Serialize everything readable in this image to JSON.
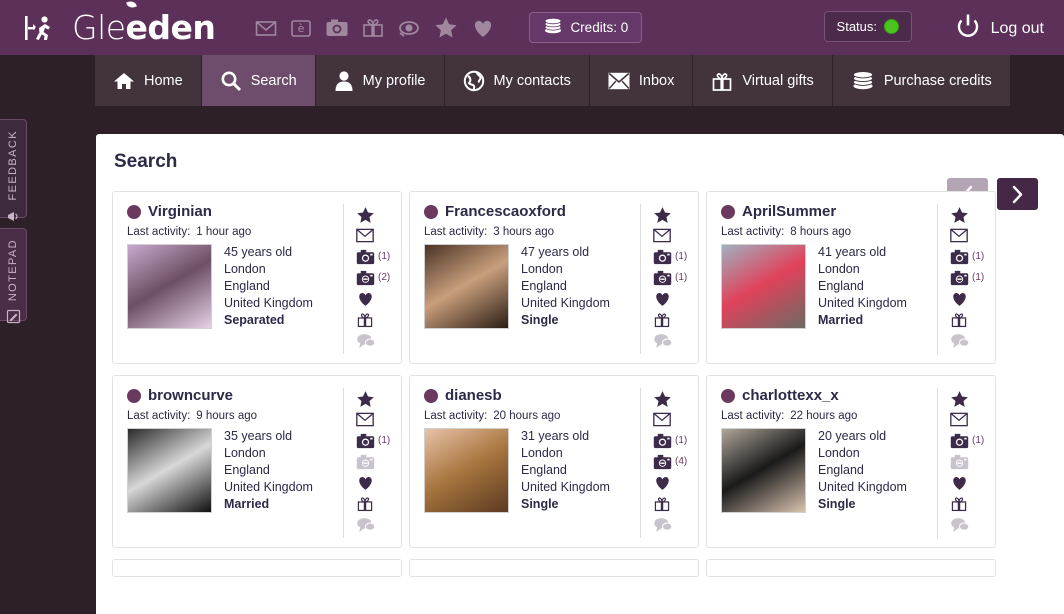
{
  "header": {
    "brand_thin": "Gle",
    "brand_bold": "eden",
    "exit_icon": "exit-running-man-icon",
    "quick_icons": [
      {
        "name": "envelope-icon",
        "glyph": "✉"
      },
      {
        "name": "winkmail-icon",
        "glyph": "è"
      },
      {
        "name": "camera-icon",
        "glyph": "◎"
      },
      {
        "name": "gift-icon",
        "glyph": "Ἰ1"
      },
      {
        "name": "eye-icon",
        "glyph": "◉"
      },
      {
        "name": "star-icon",
        "glyph": "★"
      },
      {
        "name": "heart-icon",
        "glyph": "♥"
      }
    ],
    "credits_label": "Credits: 0",
    "credits_icon": "coins-icon",
    "status_label": "Status:",
    "status_color": "#49c41c",
    "logout_label": "Log out",
    "logout_icon": "power-icon"
  },
  "nav": {
    "items": [
      {
        "label": "Home",
        "icon": "home-icon",
        "active": false
      },
      {
        "label": "Search",
        "icon": "magnifier-icon",
        "active": true
      },
      {
        "label": "My profile",
        "icon": "person-icon",
        "active": false
      },
      {
        "label": "My contacts",
        "icon": "globe-icon",
        "active": false
      },
      {
        "label": "Inbox",
        "icon": "envelope-icon",
        "active": false
      },
      {
        "label": "Virtual gifts",
        "icon": "gift-icon",
        "active": false
      },
      {
        "label": "Purchase credits",
        "icon": "coins-icon",
        "active": false
      }
    ]
  },
  "side_tabs": [
    {
      "label": "FEEDBACK",
      "icon": "megaphone-icon"
    },
    {
      "label": "NOTEPAD",
      "icon": "notepad-pencil-icon"
    }
  ],
  "main": {
    "title": "Search",
    "pager": {
      "prev_icon": "chevron-left-icon",
      "next_icon": "chevron-right-icon",
      "prev_enabled": false,
      "next_enabled": true
    },
    "activity_label": "Last activity:",
    "cards": [
      {
        "name": "Virginian",
        "last_activity": "1 hour ago",
        "age": "45 years old",
        "city": "London",
        "region": "England",
        "country": "United Kingdom",
        "status": "Separated",
        "thumb_colors": [
          "#c9a8cf",
          "#6d4f62",
          "#e6d2e8"
        ],
        "icons": [
          {
            "name": "star-icon",
            "count": "",
            "dim": false
          },
          {
            "name": "envelope-icon",
            "count": "",
            "dim": false
          },
          {
            "name": "public-photos-icon",
            "count": "(1)",
            "dim": false
          },
          {
            "name": "private-photos-icon",
            "count": "(2)",
            "dim": false
          },
          {
            "name": "heart-icon",
            "count": "",
            "dim": false
          },
          {
            "name": "gift-icon",
            "count": "",
            "dim": false
          },
          {
            "name": "chat-icon",
            "count": "",
            "dim": true
          }
        ]
      },
      {
        "name": "Francescaoxford",
        "last_activity": "3 hours ago",
        "age": "47 years old",
        "city": "London",
        "region": "England",
        "country": "United Kingdom",
        "status": "Single",
        "thumb_colors": [
          "#4a3326",
          "#c99f7c",
          "#2b1d14"
        ],
        "icons": [
          {
            "name": "star-icon",
            "count": "",
            "dim": false
          },
          {
            "name": "envelope-icon",
            "count": "",
            "dim": false
          },
          {
            "name": "public-photos-icon",
            "count": "(1)",
            "dim": false
          },
          {
            "name": "private-photos-icon",
            "count": "(1)",
            "dim": false
          },
          {
            "name": "heart-icon",
            "count": "",
            "dim": false
          },
          {
            "name": "gift-icon",
            "count": "",
            "dim": false
          },
          {
            "name": "chat-icon",
            "count": "",
            "dim": true
          }
        ]
      },
      {
        "name": "AprilSummer",
        "last_activity": "8 hours ago",
        "age": "41 years old",
        "city": "London",
        "region": "England",
        "country": "United Kingdom",
        "status": "Married",
        "thumb_colors": [
          "#9fb0c0",
          "#e0425a",
          "#6b6b63"
        ],
        "icons": [
          {
            "name": "star-icon",
            "count": "",
            "dim": false
          },
          {
            "name": "envelope-icon",
            "count": "",
            "dim": false
          },
          {
            "name": "public-photos-icon",
            "count": "(1)",
            "dim": false
          },
          {
            "name": "private-photos-icon",
            "count": "(1)",
            "dim": false
          },
          {
            "name": "heart-icon",
            "count": "",
            "dim": false
          },
          {
            "name": "gift-icon",
            "count": "",
            "dim": false
          },
          {
            "name": "chat-icon",
            "count": "",
            "dim": true
          }
        ]
      },
      {
        "name": "browncurve",
        "last_activity": "9 hours ago",
        "age": "35 years old",
        "city": "London",
        "region": "England",
        "country": "United Kingdom",
        "status": "Married",
        "thumb_colors": [
          "#2a2a2a",
          "#d8d8d8",
          "#101010"
        ],
        "icons": [
          {
            "name": "star-icon",
            "count": "",
            "dim": false
          },
          {
            "name": "envelope-icon",
            "count": "",
            "dim": false
          },
          {
            "name": "public-photos-icon",
            "count": "(1)",
            "dim": false
          },
          {
            "name": "private-photos-icon",
            "count": "",
            "dim": true
          },
          {
            "name": "heart-icon",
            "count": "",
            "dim": false
          },
          {
            "name": "gift-icon",
            "count": "",
            "dim": false
          },
          {
            "name": "chat-icon",
            "count": "",
            "dim": true
          }
        ]
      },
      {
        "name": "dianesb",
        "last_activity": "20 hours ago",
        "age": "31 years old",
        "city": "London",
        "region": "England",
        "country": "United Kingdom",
        "status": "Single",
        "thumb_colors": [
          "#e8c2a8",
          "#a8763f",
          "#5c3a21"
        ],
        "icons": [
          {
            "name": "star-icon",
            "count": "",
            "dim": false
          },
          {
            "name": "envelope-icon",
            "count": "",
            "dim": false
          },
          {
            "name": "public-photos-icon",
            "count": "(1)",
            "dim": false
          },
          {
            "name": "private-photos-icon",
            "count": "(4)",
            "dim": false
          },
          {
            "name": "heart-icon",
            "count": "",
            "dim": false
          },
          {
            "name": "gift-icon",
            "count": "",
            "dim": false
          },
          {
            "name": "chat-icon",
            "count": "",
            "dim": true
          }
        ]
      },
      {
        "name": "charlottexx_x",
        "last_activity": "22 hours ago",
        "age": "20 years old",
        "city": "London",
        "region": "England",
        "country": "United Kingdom",
        "status": "Single",
        "thumb_colors": [
          "#b0a69c",
          "#1a1a1a",
          "#d9c3b0"
        ],
        "icons": [
          {
            "name": "star-icon",
            "count": "",
            "dim": false
          },
          {
            "name": "envelope-icon",
            "count": "",
            "dim": false
          },
          {
            "name": "public-photos-icon",
            "count": "(1)",
            "dim": false
          },
          {
            "name": "private-photos-icon",
            "count": "",
            "dim": true
          },
          {
            "name": "heart-icon",
            "count": "",
            "dim": false
          },
          {
            "name": "gift-icon",
            "count": "",
            "dim": false
          },
          {
            "name": "chat-icon",
            "count": "",
            "dim": true
          }
        ]
      }
    ]
  }
}
